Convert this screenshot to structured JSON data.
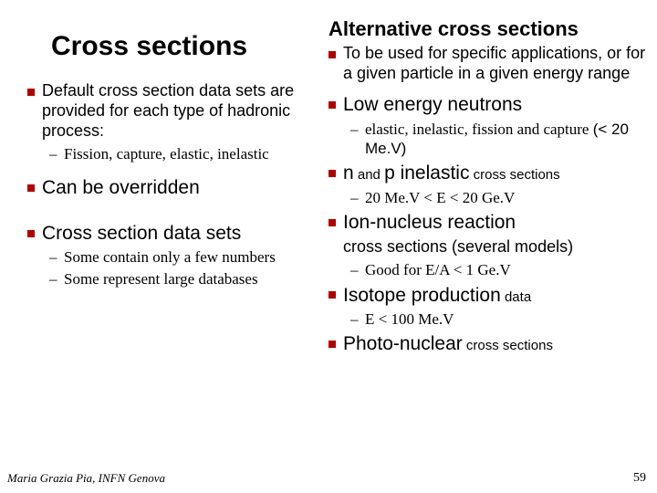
{
  "left": {
    "title": "Cross sections",
    "items": [
      {
        "text": "Default cross section data sets are provided for each type of hadronic process:",
        "sub": [
          "Fission, capture, elastic, inelastic"
        ]
      },
      {
        "text": "Can be overridden"
      },
      {
        "text": "Cross section data sets",
        "sub": [
          "Some contain only a few numbers",
          "Some represent large databases"
        ]
      }
    ]
  },
  "right": {
    "title": "Alternative cross sections",
    "items": [
      {
        "text": "To be used for specific applications, or for a given particle in a given energy range"
      },
      {
        "big_text": "Low energy neutrons",
        "sub_prefix": "elastic, inelastic, fission and capture",
        "sub_suffix": "(< 20 Me.V)"
      },
      {
        "lead1": "n",
        "mid1": " and ",
        "lead2": "p inelastic",
        "tail": " cross sections",
        "sub": [
          "20 Me.V < E < 20 Ge.V"
        ]
      },
      {
        "big_text": "Ion-nucleus reaction",
        "line2": "cross sections (several models)",
        "sub": [
          "Good for E/A < 1 Ge.V"
        ]
      },
      {
        "big_text": "Isotope production",
        "tail": " data",
        "sub": [
          "E < 100 Me.V"
        ]
      },
      {
        "big_text": "Photo-nuclear",
        "tail": " cross sections"
      }
    ]
  },
  "footer": {
    "author": "Maria Grazia Pia, INFN Genova",
    "page": "59"
  }
}
